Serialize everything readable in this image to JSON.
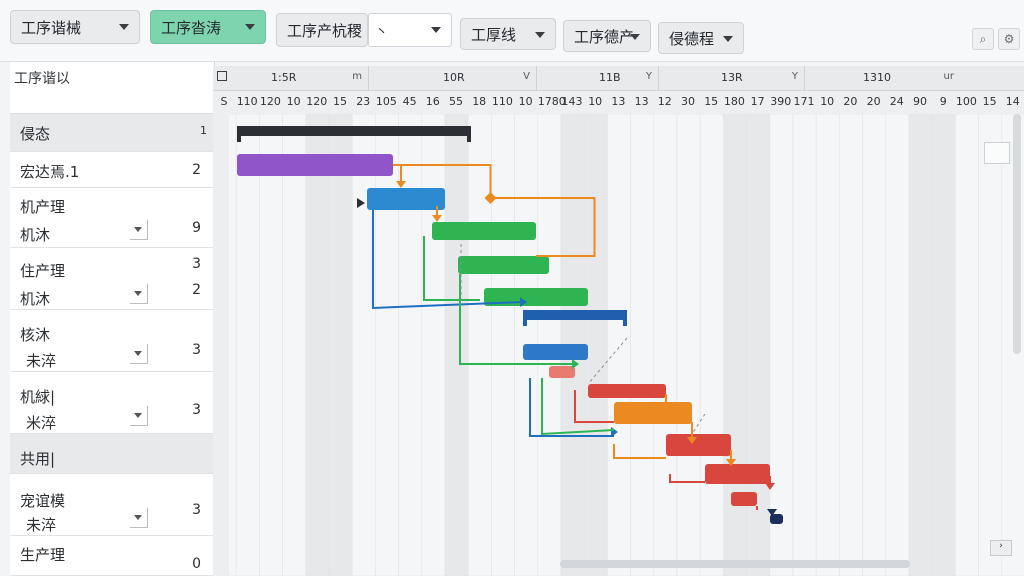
{
  "toolbar": {
    "view_select": "工序谐械",
    "active_select": "工序沓涛",
    "filter_label": "工序产杭稷",
    "filter_value": "丶",
    "select3": "工厚线",
    "select4": "工序德产",
    "select5": "侵德程"
  },
  "left_panel": {
    "header": "工序谐以",
    "rows": [
      {
        "type": "group",
        "title": "侵态",
        "num": "1"
      },
      {
        "type": "item",
        "title": "宏达焉.1",
        "num": "2"
      },
      {
        "type": "item2",
        "title": "机产理",
        "sub": "机沐",
        "num": "9"
      },
      {
        "type": "item2",
        "title": "住产理",
        "sub": "机沐",
        "num_top": "3",
        "num": "2"
      },
      {
        "type": "item2",
        "title": "核沐",
        "sub": "未淬",
        "num": "3"
      },
      {
        "type": "item2",
        "title": "机絿|",
        "sub": "米淬",
        "num": "3"
      },
      {
        "type": "group",
        "title": "共用|",
        "num": ""
      },
      {
        "type": "item2",
        "title": "宠谊模",
        "sub": "未淬",
        "num": "3"
      },
      {
        "type": "item2",
        "title": "生产理",
        "sub": "",
        "num": "0"
      }
    ]
  },
  "timeline": {
    "major": [
      {
        "label": "1:5R",
        "end": "m"
      },
      {
        "label": "10R",
        "end": "V"
      },
      {
        "label": "11B",
        "end": "Y"
      },
      {
        "label": "13R",
        "end": "Y"
      },
      {
        "label": "1310",
        "end": "ur"
      }
    ],
    "minor": [
      "S",
      "110",
      "120",
      "10",
      "120",
      "15",
      "23",
      "105",
      "45",
      "16",
      "55",
      "18",
      "110",
      "10",
      "1780",
      "143",
      "10",
      "13",
      "13",
      "12",
      "30",
      "15",
      "180",
      "17",
      "390",
      "171",
      "10",
      "20",
      "20",
      "24",
      "90",
      "9",
      "100",
      "15",
      "14"
    ]
  },
  "chart_data": {
    "type": "gantt",
    "tasks": [
      {
        "name": "summary",
        "color": "#2c2f33",
        "start": 0,
        "end": 18
      },
      {
        "name": "task-purple",
        "color": "#9055c8",
        "start": 0,
        "end": 12
      },
      {
        "name": "task-blue-1",
        "color": "#2e8ad0",
        "start": 10,
        "end": 16
      },
      {
        "name": "task-green-1",
        "color": "#2fb452",
        "start": 15,
        "end": 23
      },
      {
        "name": "task-green-2",
        "color": "#2fb452",
        "start": 17,
        "end": 24
      },
      {
        "name": "task-green-3",
        "color": "#2fb452",
        "start": 19,
        "end": 27
      },
      {
        "name": "task-blue-summary",
        "color": "#1f5fad",
        "start": 22,
        "end": 30
      },
      {
        "name": "task-blue-2",
        "color": "#2e78c8",
        "start": 22,
        "end": 27
      },
      {
        "name": "task-salmon",
        "color": "#e87a70",
        "start": 24,
        "end": 26
      },
      {
        "name": "task-red-1",
        "color": "#d8463e",
        "start": 27,
        "end": 33
      },
      {
        "name": "task-orange",
        "color": "#ec8a22",
        "start": 29,
        "end": 35
      },
      {
        "name": "task-red-2",
        "color": "#d8463e",
        "start": 33,
        "end": 38
      },
      {
        "name": "task-red-3",
        "color": "#d8463e",
        "start": 36,
        "end": 41
      },
      {
        "name": "task-red-4",
        "color": "#d8463e",
        "start": 38,
        "end": 40
      },
      {
        "name": "task-navy",
        "color": "#1b2f5c",
        "start": 41,
        "end": 42
      }
    ]
  }
}
